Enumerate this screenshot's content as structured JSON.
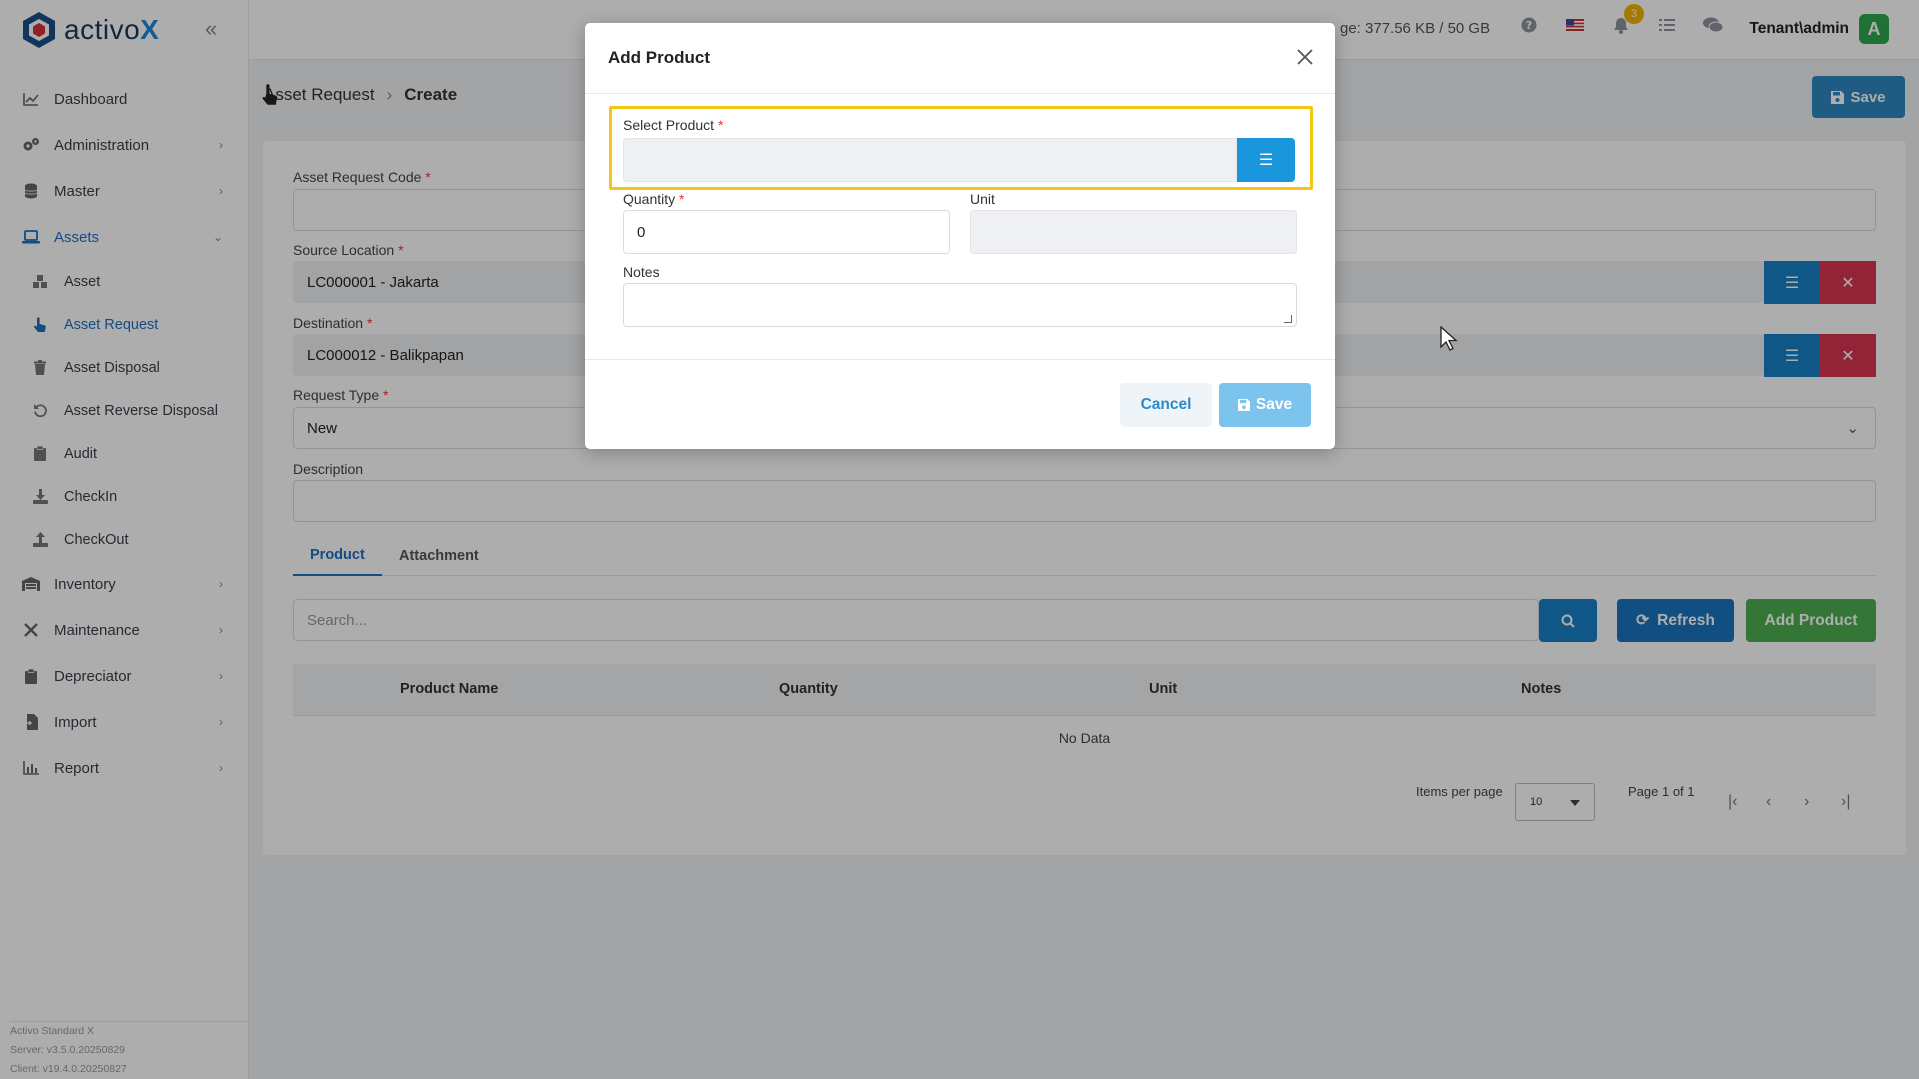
{
  "app": {
    "logo_text_main": "activo",
    "logo_text_x": "X",
    "storage_text": "ge: 377.56 KB / 50 GB",
    "notification_count": "3",
    "user_name": "Tenant\\admin",
    "avatar_letter": "A"
  },
  "sidebar": {
    "items": [
      {
        "label": "Dashboard",
        "icon": "chart-line-icon"
      },
      {
        "label": "Administration",
        "icon": "cogs-icon"
      },
      {
        "label": "Master",
        "icon": "database-icon"
      },
      {
        "label": "Assets",
        "icon": "laptop-icon"
      },
      {
        "label": "Inventory",
        "icon": "warehouse-icon"
      },
      {
        "label": "Maintenance",
        "icon": "tools-icon"
      },
      {
        "label": "Depreciator",
        "icon": "clipboard-icon"
      },
      {
        "label": "Import",
        "icon": "file-import-icon"
      },
      {
        "label": "Report",
        "icon": "chart-bar-icon"
      }
    ],
    "assets_sub": [
      {
        "label": "Asset"
      },
      {
        "label": "Asset Request"
      },
      {
        "label": "Asset Disposal"
      },
      {
        "label": "Asset Reverse Disposal"
      },
      {
        "label": "Audit"
      },
      {
        "label": "CheckIn"
      },
      {
        "label": "CheckOut"
      }
    ],
    "footer": {
      "line1": "Activo Standard X",
      "line2": "Server: v3.5.0.20250829",
      "line3": "Client: v19.4.0.20250827"
    }
  },
  "breadcrumb": {
    "parent": "Asset Request",
    "current": "Create"
  },
  "top_save_label": "Save",
  "form": {
    "code_label": "Asset Request Code",
    "code_value": "",
    "source_label": "Source Location",
    "source_value": "LC000001 - Jakarta",
    "destination_label": "Destination",
    "destination_value": "LC000012 - Balikpapan",
    "request_type_label": "Request Type",
    "request_type_value": "New",
    "description_label": "Description",
    "description_value": ""
  },
  "tabs": [
    {
      "label": "Product"
    },
    {
      "label": "Attachment"
    }
  ],
  "toolbar": {
    "search_placeholder": "Search...",
    "refresh_label": "Refresh",
    "add_product_label": "Add Product"
  },
  "table": {
    "columns": [
      "Product Name",
      "Quantity",
      "Unit",
      "Notes"
    ],
    "empty_text": "No Data"
  },
  "pagination": {
    "items_per_page_label": "Items per page",
    "items_per_page_value": "10",
    "page_info": "Page 1 of 1"
  },
  "modal": {
    "title": "Add Product",
    "select_product_label": "Select Product",
    "select_product_value": "",
    "quantity_label": "Quantity",
    "quantity_value": "0",
    "unit_label": "Unit",
    "unit_value": "",
    "notes_label": "Notes",
    "notes_value": "",
    "cancel_label": "Cancel",
    "save_label": "Save"
  },
  "colors": {
    "primary_blue": "#1580c8",
    "danger_red": "#d93553",
    "success_green": "#4caf50",
    "highlight_yellow": "#f5c518"
  }
}
